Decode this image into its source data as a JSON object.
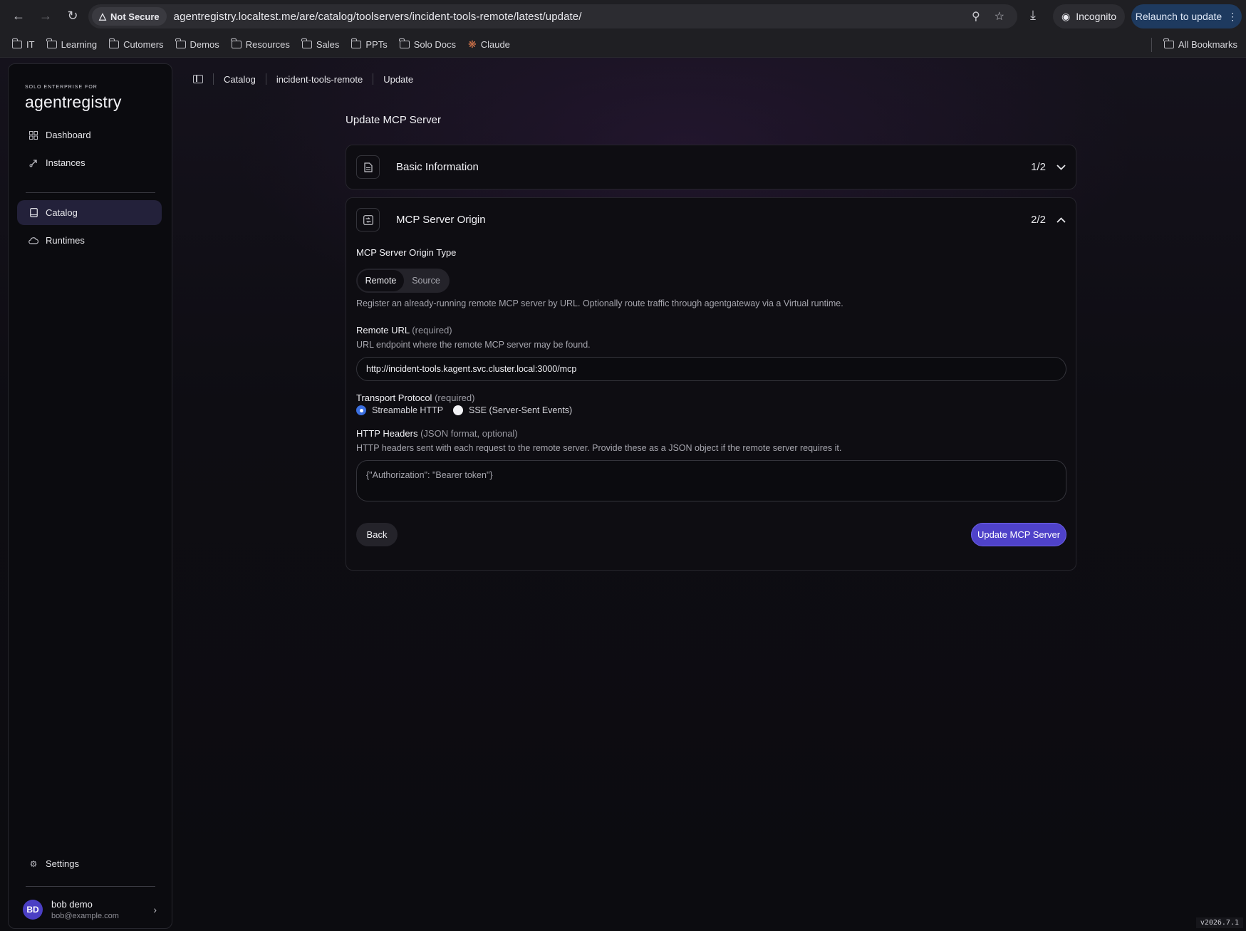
{
  "browser": {
    "security_label": "Not Secure",
    "url": "agentregistry.localtest.me/are/catalog/toolservers/incident-tools-remote/latest/update/",
    "incognito_label": "Incognito",
    "relaunch_label": "Relaunch to update",
    "bookmarks": [
      "IT",
      "Learning",
      "Cutomers",
      "Demos",
      "Resources",
      "Sales",
      "PPTs",
      "Solo Docs",
      "Claude"
    ],
    "all_bookmarks_label": "All Bookmarks"
  },
  "sidebar": {
    "brand_small": "SOLO ENTERPRISE FOR",
    "brand": "agentregistry",
    "items": [
      {
        "label": "Dashboard",
        "icon": "grid-icon"
      },
      {
        "label": "Instances",
        "icon": "rocket-icon"
      },
      {
        "label": "Catalog",
        "icon": "book-icon",
        "active": true
      },
      {
        "label": "Runtimes",
        "icon": "cloud-icon"
      }
    ],
    "settings_label": "Settings",
    "user": {
      "initials": "BD",
      "name": "bob demo",
      "email": "bob@example.com"
    }
  },
  "breadcrumb": [
    "Catalog",
    "incident-tools-remote",
    "Update"
  ],
  "page_title": "Update MCP Server",
  "sections": {
    "basic": {
      "title": "Basic Information",
      "step": "1/2"
    },
    "origin": {
      "title": "MCP Server Origin",
      "step": "2/2"
    }
  },
  "form": {
    "origin_type_label": "MCP Server Origin Type",
    "origin_options": [
      "Remote",
      "Source"
    ],
    "origin_selected": "Remote",
    "origin_description": "Register an already-running remote MCP server by URL. Optionally route traffic through agentgateway via a Virtual runtime.",
    "remote_url_label": "Remote URL",
    "remote_url_req": "(required)",
    "remote_url_desc": "URL endpoint where the remote MCP server may be found.",
    "remote_url_value": "http://incident-tools.kagent.svc.cluster.local:3000/mcp",
    "transport_label": "Transport Protocol",
    "transport_req": "(required)",
    "transport_options": [
      "Streamable HTTP",
      "SSE (Server-Sent Events)"
    ],
    "transport_selected": "Streamable HTTP",
    "headers_label": "HTTP Headers",
    "headers_req": "(JSON format, optional)",
    "headers_desc": "HTTP headers sent with each request to the remote server. Provide these as a JSON object if the remote server requires it.",
    "headers_placeholder": "{\"Authorization\": \"Bearer token\"}",
    "back_label": "Back",
    "submit_label": "Update MCP Server"
  },
  "version": "v2026.7.1",
  "colors": {
    "accent": "#4f42c9",
    "radio": "#3b6fe0"
  }
}
